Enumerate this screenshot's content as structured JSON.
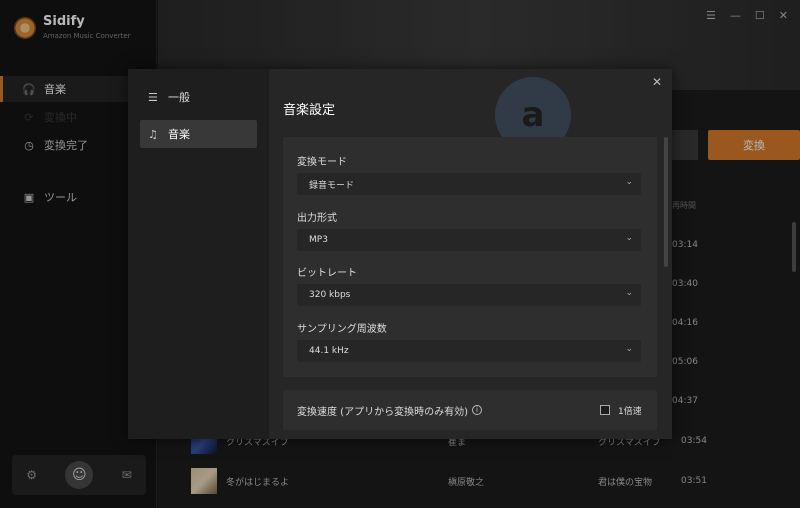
{
  "brand": {
    "name": "Sidify",
    "subtitle": "Amazon Music Converter"
  },
  "sidebar": {
    "items": [
      {
        "label": "音楽",
        "icon": "headphones-icon"
      },
      {
        "label": "変換中",
        "icon": "sync-icon"
      },
      {
        "label": "変換完了",
        "icon": "clock-icon"
      },
      {
        "label": "ツール",
        "icon": "toolbox-icon"
      }
    ]
  },
  "window": {
    "menu": "☰",
    "minimize": "—",
    "maximize": "☐",
    "close": "✕"
  },
  "main": {
    "convert_label": "変換",
    "duration_header": "再時間",
    "durations": [
      "03:14",
      "03:40",
      "04:16",
      "05:06",
      "04:37",
      "03:54",
      "03:51"
    ],
    "tracks": [
      {
        "title": "クリスマスイブ",
        "artist": "崔ま",
        "album": "クリスマスイブ",
        "duration": "03:54"
      },
      {
        "title": "冬がはじまるよ",
        "artist": "槇原敬之",
        "album": "君は僕の宝物",
        "duration": "03:51"
      }
    ]
  },
  "modal": {
    "nav": [
      {
        "label": "一般",
        "icon": "sliders-icon"
      },
      {
        "label": "音楽",
        "icon": "music-note-icon"
      }
    ],
    "title": "音楽設定",
    "fields": [
      {
        "label": "変換モード",
        "value": "録音モード"
      },
      {
        "label": "出力形式",
        "value": "MP3"
      },
      {
        "label": "ビットレート",
        "value": "320 kbps"
      },
      {
        "label": "サンプリング周波数",
        "value": "44.1 kHz"
      }
    ],
    "speed_label": "変換速度 (アプリから変換時のみ有効)",
    "speed_option": "1倍速",
    "close": "✕"
  }
}
